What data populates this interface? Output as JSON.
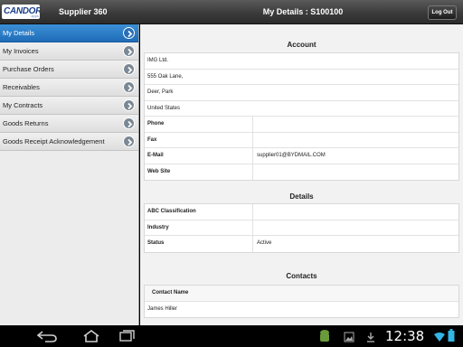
{
  "header": {
    "logo_text": "CANDOR",
    "logo_subtext": "apps",
    "app_title": "Supplier 360",
    "page_title": "My Details : S100100",
    "logout_label": "Log Out"
  },
  "sidebar": {
    "items": [
      {
        "label": "My Details",
        "active": true
      },
      {
        "label": "My Invoices",
        "active": false
      },
      {
        "label": "Purchase Orders",
        "active": false
      },
      {
        "label": "Receivables",
        "active": false
      },
      {
        "label": "My Contracts",
        "active": false
      },
      {
        "label": "Goods Returns",
        "active": false
      },
      {
        "label": "Goods Receipt Acknowledgement",
        "active": false
      }
    ]
  },
  "account": {
    "title": "Account",
    "address_lines": [
      "IMG Ltd.",
      "555 Oak Lane,",
      "Deer, Park",
      "United States"
    ],
    "fields": [
      {
        "label": "Phone",
        "value": ""
      },
      {
        "label": "Fax",
        "value": ""
      },
      {
        "label": "E-Mail",
        "value": "supplier01@BYDMAIL.COM"
      },
      {
        "label": "Web Site",
        "value": ""
      }
    ]
  },
  "details": {
    "title": "Details",
    "fields": [
      {
        "label": "ABC Classification",
        "value": ""
      },
      {
        "label": "Industry",
        "value": ""
      },
      {
        "label": "Status",
        "value": "Active"
      }
    ]
  },
  "contacts": {
    "title": "Contacts",
    "header": "Contact Name",
    "rows": [
      "James Hiller"
    ]
  },
  "status_bar": {
    "time": "12:38",
    "colors": {
      "accent": "#2a7fd0",
      "signal": "#33b5e5"
    }
  }
}
